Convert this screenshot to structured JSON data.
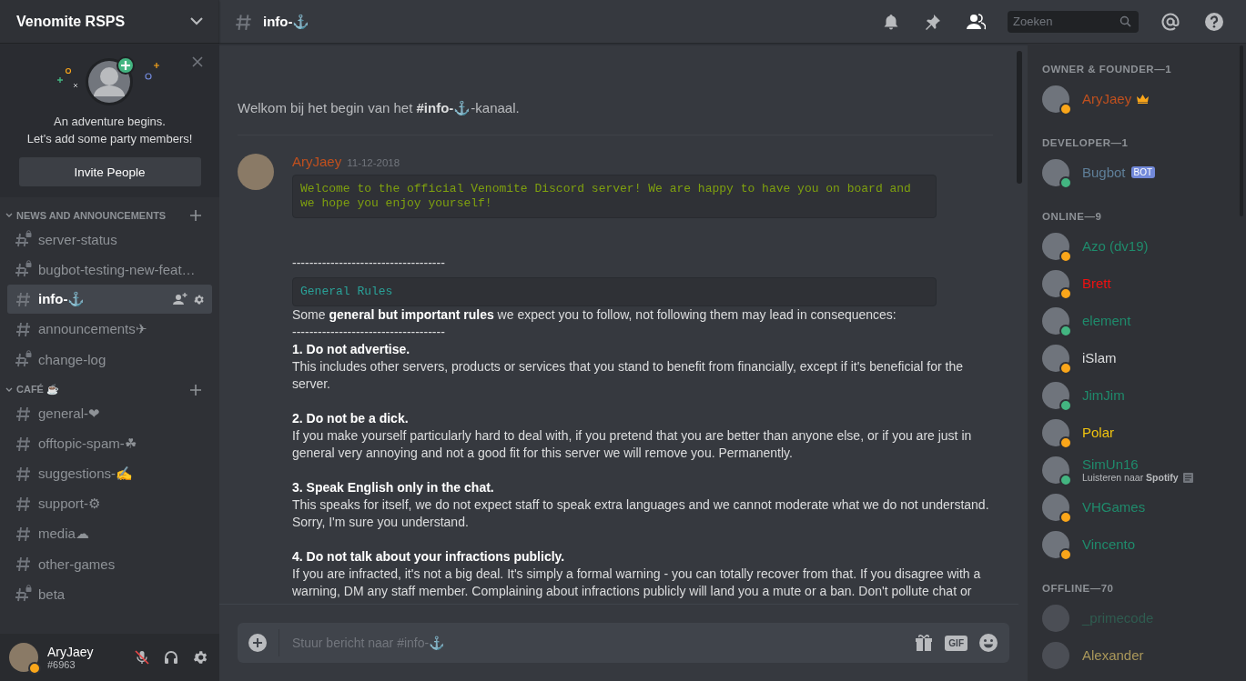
{
  "server": {
    "name": "Venomite RSPS"
  },
  "invite_card": {
    "line_1": "An adventure begins.",
    "line_2": "Let's add some party members!",
    "button": "Invite People"
  },
  "categories": [
    {
      "name": "NEWS AND ANNOUNCEMENTS",
      "channels": [
        {
          "name": "server-status",
          "kind": "locked",
          "selected": false
        },
        {
          "name": "bugbot-testing-new-feat…",
          "kind": "locked",
          "selected": false
        },
        {
          "name": "info-⚓",
          "kind": "text",
          "selected": true
        },
        {
          "name": "announcements✈",
          "kind": "text",
          "selected": false
        },
        {
          "name": "change-log",
          "kind": "locked",
          "selected": false
        }
      ]
    },
    {
      "name": "CAFÉ ☕",
      "channels": [
        {
          "name": "general-❤",
          "kind": "text",
          "selected": false
        },
        {
          "name": "offtopic-spam-☘",
          "kind": "text",
          "selected": false
        },
        {
          "name": "suggestions-✍",
          "kind": "text",
          "selected": false
        },
        {
          "name": "support-⚙",
          "kind": "text",
          "selected": false
        },
        {
          "name": "media☁",
          "kind": "text",
          "selected": false
        },
        {
          "name": "other-games",
          "kind": "text",
          "selected": false
        },
        {
          "name": "beta",
          "kind": "locked",
          "selected": false
        }
      ]
    }
  ],
  "user_panel": {
    "name": "AryJaey",
    "tag": "#6963",
    "status": {
      "color": "#faa61a"
    },
    "mic_muted": true
  },
  "header": {
    "channel": "info-⚓",
    "search_placeholder": "Zoeken",
    "members_shown": true
  },
  "welcome": "Welkom bij het begin van het **#info-⚓**-kanaal.",
  "messages": [
    {
      "author": {
        "name": "AryJaey",
        "color": "#c0501e"
      },
      "timestamp": "11-12-2018",
      "blocks": [
        {
          "kind": "code",
          "color": "#7fa00f",
          "text": "Welcome to the official Venomite Discord server! We are happy to have you on board and we hope you enjoy yourself!"
        },
        {
          "kind": "dash",
          "text": "------------------------------------"
        },
        {
          "kind": "code",
          "color": "#2aa198",
          "text": "General Rules"
        },
        {
          "kind": "text",
          "text": "Some **general but important rules** we expect you to follow, not following them may lead in consequences:"
        },
        {
          "kind": "dash",
          "text": "------------------------------------"
        },
        {
          "kind": "heading",
          "text": "1. Do not advertise."
        },
        {
          "kind": "text",
          "text": "This includes other servers, products or services that you stand to benefit from financially, except if it's beneficial for the server."
        },
        {
          "kind": "heading",
          "text": "2. Do not be a dick."
        },
        {
          "kind": "text",
          "text": "If you make yourself particularly hard to deal with, if you pretend that you are better than anyone else, or if you are just in general very annoying and not a good fit for this server we will remove you. Permanently."
        },
        {
          "kind": "heading",
          "text": "3. Speak English only in the chat."
        },
        {
          "kind": "text",
          "text": "This speaks for itself, we do not expect staff to speak extra languages and we cannot moderate what we do not understand. Sorry, I'm sure you understand."
        },
        {
          "kind": "heading",
          "text": "4. Do not talk about your infractions publicly."
        },
        {
          "kind": "text",
          "text": "If you are infracted, it's not a big deal. It's simply a formal warning - you can totally recover from that. If you disagree with a warning, DM any staff member. Complaining about infractions publicly will land you a mute or a ban. Don't pollute chat or"
        }
      ]
    }
  ],
  "composer": {
    "placeholder": "Stuur bericht naar #info-⚓",
    "gif": "GIF"
  },
  "member_groups": [
    {
      "title": "OWNER & FOUNDER—1",
      "members": [
        {
          "name": "AryJaey",
          "color": "#c0501e",
          "status": {
            "color": "#faa61a"
          },
          "offline": false,
          "crown": true
        }
      ]
    },
    {
      "title": "DEVELOPER—1",
      "members": [
        {
          "name": "Bugbot",
          "color": "#5f7f99",
          "status": {
            "color": "#43b581"
          },
          "offline": false,
          "bot_tag": "BOT"
        }
      ]
    },
    {
      "title": "ONLINE—9",
      "members": [
        {
          "name": "Azo (dv19)",
          "color": "#1f8b6c",
          "status": {
            "color": "#faa61a"
          },
          "offline": false
        },
        {
          "name": "Brett",
          "color": "#f01010",
          "status": {
            "color": "#faa61a"
          },
          "offline": false
        },
        {
          "name": "element",
          "color": "#1f8b6c",
          "status": {
            "color": "#43b581"
          },
          "offline": false
        },
        {
          "name": "iSlam",
          "color": "#dcddde",
          "status": {
            "color": "#faa61a"
          },
          "offline": false
        },
        {
          "name": "JimJim",
          "color": "#1f8b6c",
          "status": {
            "color": "#43b581"
          },
          "offline": false
        },
        {
          "name": "Polar",
          "color": "#f1c40f",
          "status": {
            "color": "#faa61a"
          },
          "offline": false
        },
        {
          "name": "SimUn16",
          "color": "#1f8b6c",
          "status": {
            "color": "#43b581"
          },
          "offline": false,
          "activity": "Luisteren naar **Spotify**"
        },
        {
          "name": "VHGames",
          "color": "#1f8b6c",
          "status": {
            "color": "#faa61a"
          },
          "offline": false
        },
        {
          "name": "Vincento",
          "color": "#1f8b6c",
          "status": {
            "color": "#faa61a"
          },
          "offline": false
        }
      ]
    },
    {
      "title": "OFFLINE—70",
      "members": [
        {
          "name": "_primecode",
          "color": "#2f5c50",
          "offline": true
        },
        {
          "name": "Alexander",
          "color": "#a9975a",
          "offline": true
        }
      ]
    }
  ]
}
